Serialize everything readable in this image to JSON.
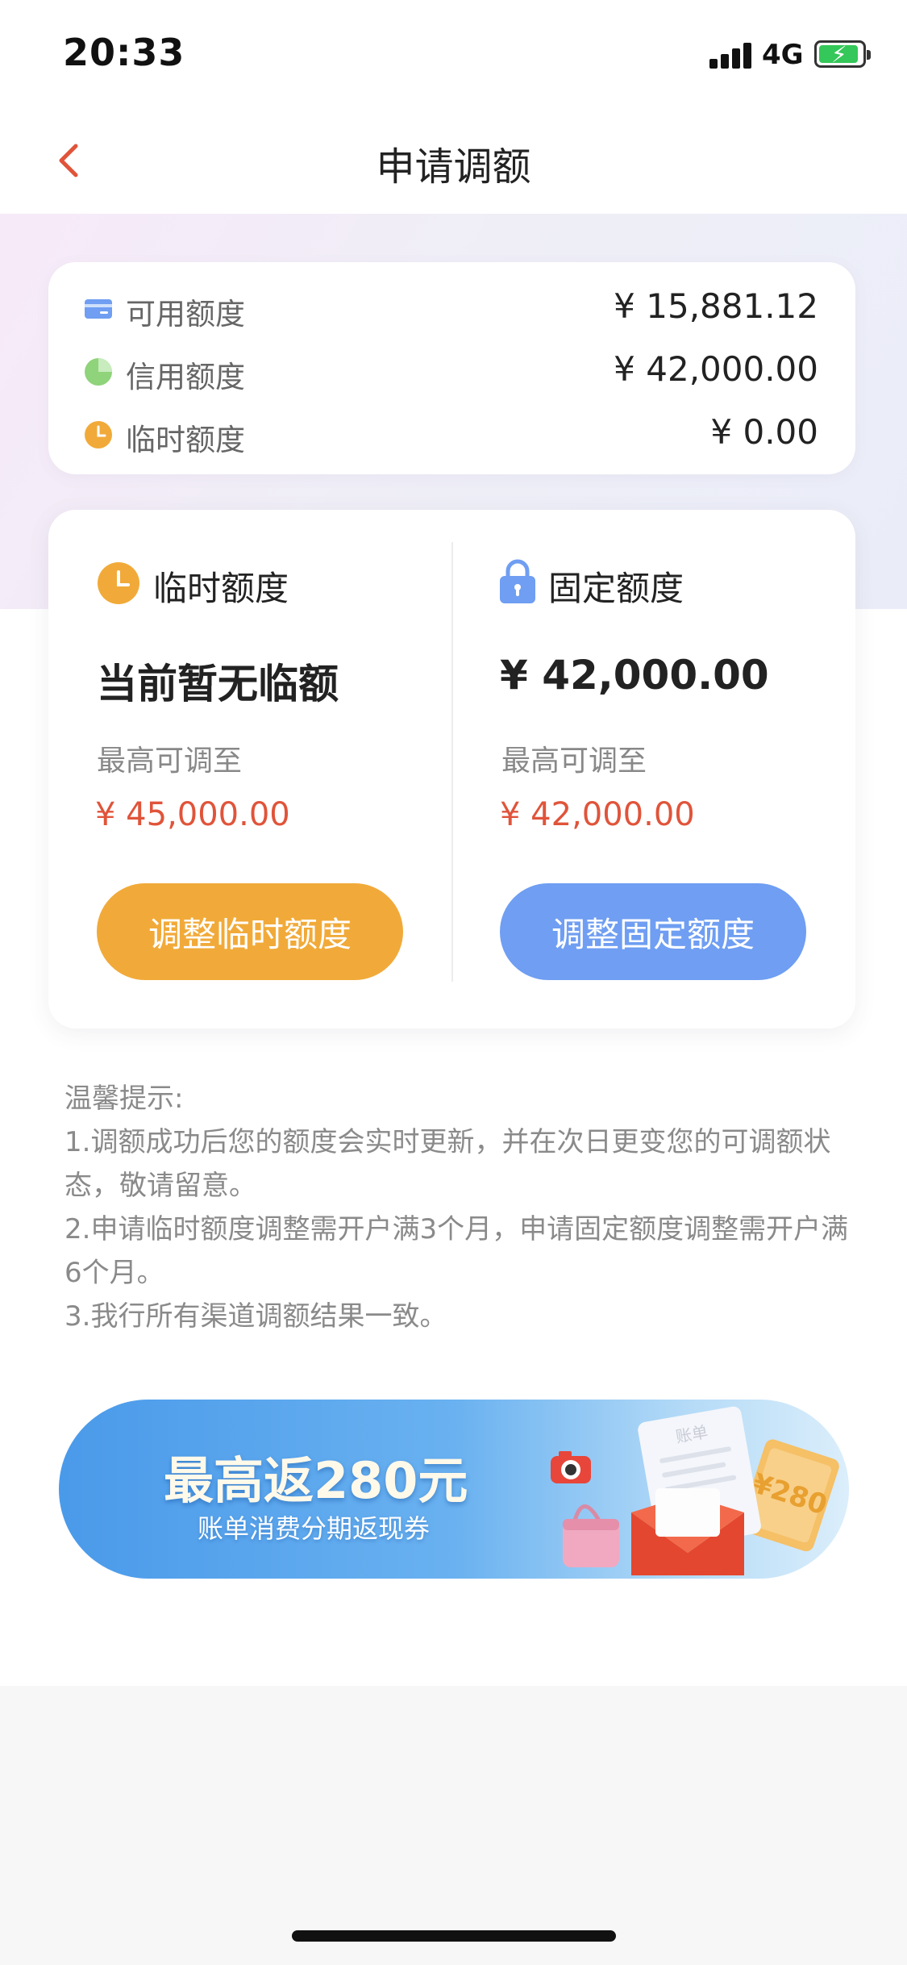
{
  "status_bar": {
    "time": "20:33",
    "network": "4G",
    "battery_charging": true
  },
  "nav": {
    "title": "申请调额",
    "back_icon": "chevron-left-icon"
  },
  "summary": {
    "rows": [
      {
        "icon": "card-icon",
        "label": "可用额度",
        "value": "¥ 15,881.12"
      },
      {
        "icon": "pie-icon",
        "label": "信用额度",
        "value": "¥ 42,000.00"
      },
      {
        "icon": "clock-icon",
        "label": "临时额度",
        "value": "¥ 0.00"
      }
    ]
  },
  "temp_limit": {
    "icon": "clock-icon",
    "title": "临时额度",
    "current": "当前暂无临额",
    "max_label": "最高可调至",
    "max_value": "¥ 45,000.00",
    "button": "调整临时额度"
  },
  "fixed_limit": {
    "icon": "lock-icon",
    "title": "固定额度",
    "current": "¥ 42,000.00",
    "max_label": "最高可调至",
    "max_value": "¥ 42,000.00",
    "button": "调整固定额度"
  },
  "tips": {
    "heading": "温馨提示:",
    "items": [
      "1.调额成功后您的额度会实时更新，并在次日更变您的可调额状态，敬请留意。",
      "2.申请临时额度调整需开户满3个月，申请固定额度调整需开户满6个月。",
      "3.我行所有渠道调额结果一致。"
    ]
  },
  "banner": {
    "title": "最高返280元",
    "subtitle": "账单消费分期返现券",
    "art_bill_label": "账单",
    "art_coupon_label": "¥280"
  },
  "colors": {
    "accent_red": "#e0543a",
    "orange": "#f1aa39",
    "blue": "#6f9ef2",
    "green": "#8fd37a"
  }
}
